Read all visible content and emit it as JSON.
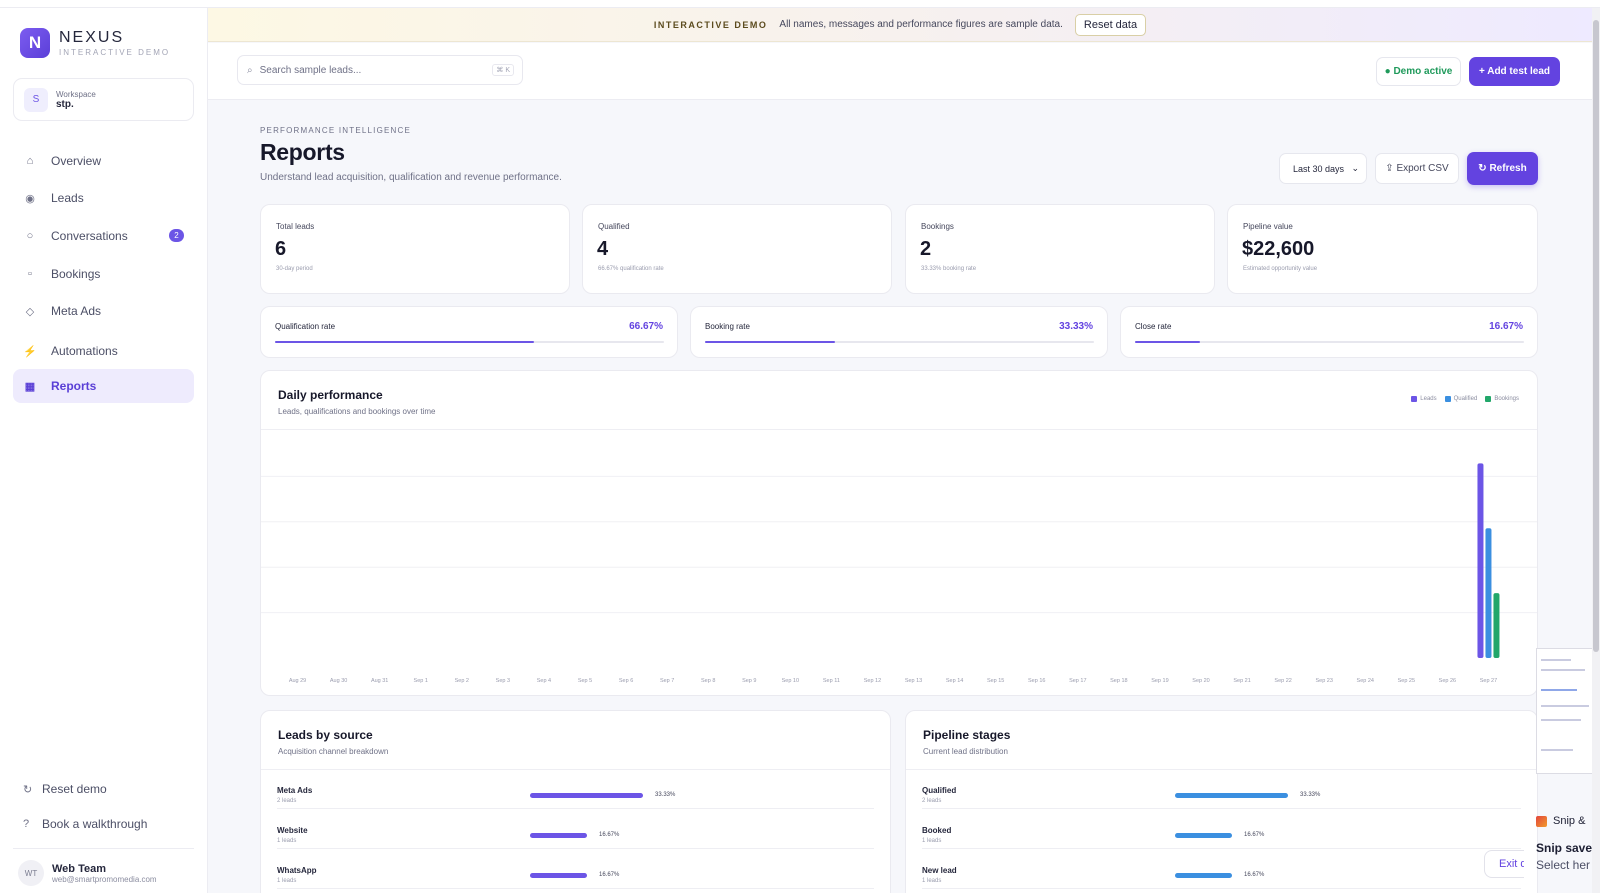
{
  "brand": {
    "logo_letter": "N",
    "name": "NEXUS",
    "subtitle": "INTERACTIVE DEMO"
  },
  "workspace": {
    "avatar": "S",
    "label": "Workspace",
    "value": "stp."
  },
  "sidebar": {
    "items": [
      {
        "label": "Overview",
        "icon": "home-icon",
        "glyph": "⌂"
      },
      {
        "label": "Leads",
        "icon": "target-icon",
        "glyph": "◉"
      },
      {
        "label": "Conversations",
        "icon": "chat-icon",
        "glyph": "○",
        "badge": "2"
      },
      {
        "label": "Bookings",
        "icon": "calendar-icon",
        "glyph": "▫"
      },
      {
        "label": "Meta Ads",
        "icon": "diamond-icon",
        "glyph": "◇"
      },
      {
        "label": "Automations",
        "icon": "bolt-icon",
        "glyph": "⚡"
      },
      {
        "label": "Reports",
        "icon": "chart-icon",
        "glyph": "▦",
        "active": true
      }
    ],
    "reset": "Reset demo",
    "walkthrough": "Book a walkthrough",
    "user": {
      "initials": "WT",
      "name": "Web Team",
      "email": "web@smartpromomedia.com"
    }
  },
  "banner": {
    "tag": "INTERACTIVE DEMO",
    "message": "All names, messages and performance figures are sample data.",
    "button": "Reset data"
  },
  "header": {
    "search_placeholder": "Search sample leads...",
    "search_shortcut": "⌘ K",
    "demo_status": "● Demo active",
    "add_button": "+ Add test lead"
  },
  "page": {
    "eyebrow": "PERFORMANCE INTELLIGENCE",
    "title": "Reports",
    "description": "Understand lead acquisition, qualification and revenue performance.",
    "range": "Last 30 days",
    "export": "⇪ Export CSV",
    "refresh": "↻ Refresh"
  },
  "kpis": [
    {
      "label": "Total leads",
      "value": "6",
      "sub": "30-day period"
    },
    {
      "label": "Qualified",
      "value": "4",
      "sub": "66.67% qualification rate"
    },
    {
      "label": "Bookings",
      "value": "2",
      "sub": "33.33% booking rate"
    },
    {
      "label": "Pipeline value",
      "value": "$22,600",
      "sub": "Estimated opportunity value"
    }
  ],
  "rates": [
    {
      "label": "Qualification rate",
      "value": "66.67%",
      "pct": 66.67
    },
    {
      "label": "Booking rate",
      "value": "33.33%",
      "pct": 33.33
    },
    {
      "label": "Close rate",
      "value": "16.67%",
      "pct": 16.67
    }
  ],
  "chart_title": "Daily performance",
  "chart_subtitle": "Leads, qualifications and bookings over time",
  "chart_data": {
    "type": "bar",
    "categories": [
      "Aug 29",
      "Aug 30",
      "Aug 31",
      "Sep 1",
      "Sep 2",
      "Sep 3",
      "Sep 4",
      "Sep 5",
      "Sep 6",
      "Sep 7",
      "Sep 8",
      "Sep 9",
      "Sep 10",
      "Sep 11",
      "Sep 12",
      "Sep 13",
      "Sep 14",
      "Sep 15",
      "Sep 16",
      "Sep 17",
      "Sep 18",
      "Sep 19",
      "Sep 20",
      "Sep 21",
      "Sep 22",
      "Sep 23",
      "Sep 24",
      "Sep 25",
      "Sep 26",
      "Sep 27"
    ],
    "series": [
      {
        "name": "Leads",
        "color": "#6c55e6",
        "values": [
          0,
          0,
          0,
          0,
          0,
          0,
          0,
          0,
          0,
          0,
          0,
          0,
          0,
          0,
          0,
          0,
          0,
          0,
          0,
          0,
          0,
          0,
          0,
          0,
          0,
          0,
          0,
          0,
          0,
          6
        ]
      },
      {
        "name": "Qualified",
        "color": "#3b8fe0",
        "values": [
          0,
          0,
          0,
          0,
          0,
          0,
          0,
          0,
          0,
          0,
          0,
          0,
          0,
          0,
          0,
          0,
          0,
          0,
          0,
          0,
          0,
          0,
          0,
          0,
          0,
          0,
          0,
          0,
          0,
          4
        ]
      },
      {
        "name": "Bookings",
        "color": "#22a76a",
        "values": [
          0,
          0,
          0,
          0,
          0,
          0,
          0,
          0,
          0,
          0,
          0,
          0,
          0,
          0,
          0,
          0,
          0,
          0,
          0,
          0,
          0,
          0,
          0,
          0,
          0,
          0,
          0,
          0,
          0,
          2
        ]
      }
    ],
    "ylim": [
      0,
      7
    ],
    "legend": "top-right",
    "grid": true
  },
  "sources": {
    "title": "Leads by source",
    "subtitle": "Acquisition channel breakdown",
    "rows": [
      {
        "name": "Meta Ads",
        "count": "2 leads",
        "pct_label": "33.33%",
        "pct": 33.33
      },
      {
        "name": "Website",
        "count": "1 leads",
        "pct_label": "16.67%",
        "pct": 16.67
      },
      {
        "name": "WhatsApp",
        "count": "1 leads",
        "pct_label": "16.67%",
        "pct": 16.67
      }
    ]
  },
  "stages": {
    "title": "Pipeline stages",
    "subtitle": "Current lead distribution",
    "rows": [
      {
        "name": "Qualified",
        "count": "2 leads",
        "pct_label": "33.33%",
        "pct": 33.33
      },
      {
        "name": "Booked",
        "count": "1 leads",
        "pct_label": "16.67%",
        "pct": 16.67
      },
      {
        "name": "New lead",
        "count": "1 leads",
        "pct_label": "16.67%",
        "pct": 16.67
      }
    ]
  },
  "snip": {
    "app": "Snip &",
    "title": "Snip save",
    "subtitle": "Select her",
    "exit": "Exit d"
  },
  "colors": {
    "accent": "#6343e0",
    "purple_bar": "#6c55e6",
    "blue_bar": "#3b8fe0",
    "green": "#22a76a"
  }
}
